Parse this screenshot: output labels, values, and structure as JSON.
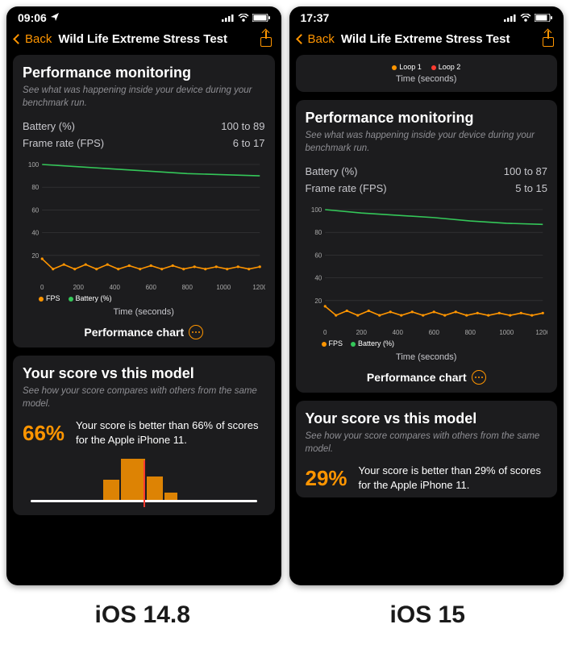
{
  "left": {
    "status_time": "09:06",
    "nav": {
      "back": "Back",
      "title": "Wild Life Extreme Stress Test"
    },
    "perf": {
      "heading": "Performance monitoring",
      "sub": "See what was happening inside your device during your benchmark run.",
      "battery_label": "Battery (%)",
      "battery_value": "100 to 89",
      "fps_label": "Frame rate (FPS)",
      "fps_value": "6 to 17",
      "legend_fps": "FPS",
      "legend_bat": "Battery (%)",
      "xlabel": "Time (seconds)",
      "link": "Performance chart"
    },
    "score": {
      "heading": "Your score vs this model",
      "sub": "See how your score compares with others from the same model.",
      "pct": "66%",
      "text": "Your score is better than 66% of scores for the Apple iPhone 11."
    },
    "footer": "iOS 14.8"
  },
  "right": {
    "status_time": "17:37",
    "nav": {
      "back": "Back",
      "title": "Wild Life Extreme Stress Test"
    },
    "top_legend": {
      "loop1": "Loop 1",
      "loop2": "Loop 2",
      "xlabel": "Time (seconds)"
    },
    "perf": {
      "heading": "Performance monitoring",
      "sub": "See what was happening inside your device during your benchmark run.",
      "battery_label": "Battery (%)",
      "battery_value": "100 to 87",
      "fps_label": "Frame rate (FPS)",
      "fps_value": "5 to 15",
      "legend_fps": "FPS",
      "legend_bat": "Battery (%)",
      "xlabel": "Time (seconds)",
      "link": "Performance chart"
    },
    "score": {
      "heading": "Your score vs this model",
      "sub": "See how your score compares with others from the same model.",
      "pct": "29%",
      "text": "Your score is better than 29% of scores for the Apple iPhone 11."
    },
    "footer": "iOS 15"
  },
  "chart_data": [
    {
      "id": "left-perf",
      "type": "line",
      "title": "Performance monitoring (iOS 14.8)",
      "xlabel": "Time (seconds)",
      "ylabel": "",
      "xlim": [
        0,
        1200
      ],
      "ylim": [
        0,
        100
      ],
      "x_ticks": [
        0,
        200,
        400,
        600,
        800,
        1000,
        1200
      ],
      "y_ticks": [
        20,
        40,
        60,
        80,
        100
      ],
      "series": [
        {
          "name": "Battery (%)",
          "color": "#34c759",
          "x": [
            0,
            200,
            400,
            600,
            800,
            1000,
            1200
          ],
          "values": [
            100,
            98,
            96,
            94,
            92,
            91,
            90
          ]
        },
        {
          "name": "FPS",
          "color": "#ff9500",
          "x": [
            0,
            60,
            120,
            180,
            240,
            300,
            360,
            420,
            480,
            540,
            600,
            660,
            720,
            780,
            840,
            900,
            960,
            1020,
            1080,
            1140,
            1200
          ],
          "values": [
            17,
            8,
            12,
            8,
            12,
            8,
            12,
            8,
            11,
            8,
            11,
            8,
            11,
            8,
            10,
            8,
            10,
            8,
            10,
            8,
            10
          ]
        }
      ]
    },
    {
      "id": "right-perf",
      "type": "line",
      "title": "Performance monitoring (iOS 15)",
      "xlabel": "Time (seconds)",
      "ylabel": "",
      "xlim": [
        0,
        1200
      ],
      "ylim": [
        0,
        100
      ],
      "x_ticks": [
        0,
        200,
        400,
        600,
        800,
        1000,
        1200
      ],
      "y_ticks": [
        20,
        40,
        60,
        80,
        100
      ],
      "series": [
        {
          "name": "Battery (%)",
          "color": "#34c759",
          "x": [
            0,
            200,
            400,
            600,
            800,
            1000,
            1200
          ],
          "values": [
            100,
            97,
            95,
            93,
            90,
            88,
            87
          ]
        },
        {
          "name": "FPS",
          "color": "#ff9500",
          "x": [
            0,
            60,
            120,
            180,
            240,
            300,
            360,
            420,
            480,
            540,
            600,
            660,
            720,
            780,
            840,
            900,
            960,
            1020,
            1080,
            1140,
            1200
          ],
          "values": [
            15,
            7,
            11,
            7,
            11,
            7,
            10,
            7,
            10,
            7,
            10,
            7,
            10,
            7,
            9,
            7,
            9,
            7,
            9,
            7,
            9
          ]
        }
      ]
    }
  ]
}
